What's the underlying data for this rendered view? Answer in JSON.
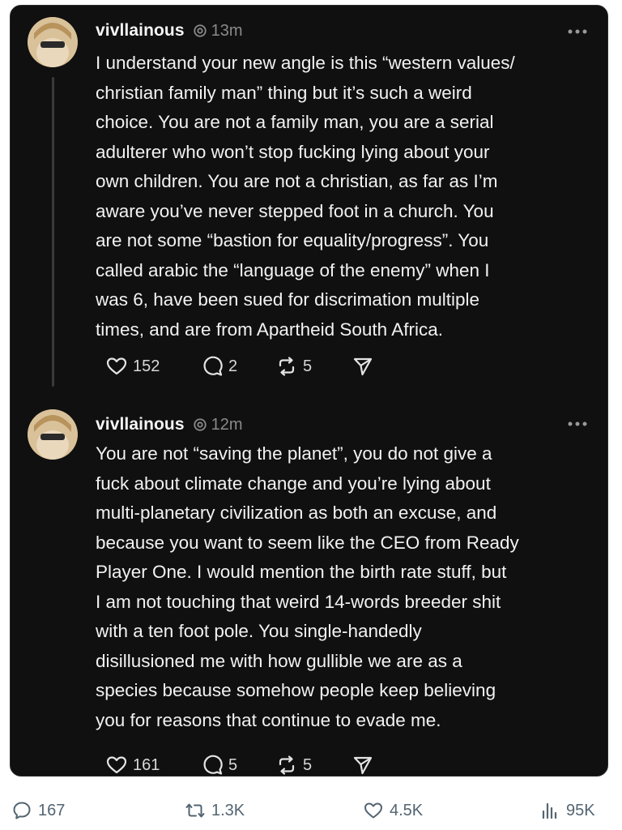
{
  "posts": [
    {
      "username": "vivllainous",
      "time": "13m",
      "text": "I understand your new angle is this “western values/\nchristian family man” thing but it’s such a weird\nchoice. You are not a family man, you are a serial\nadulterer who won’t stop fucking lying about your\nown children. You are not a christian, as far as I’m\naware you’ve never stepped foot in a church. You\nare not some “bastion for equality/progress”. You\ncalled arabic the “language of the enemy” when I\nwas 6, have been sued for discrimation multiple\ntimes, and are from Apartheid South Africa.",
      "likes": "152",
      "replies": "2",
      "reposts": "5"
    },
    {
      "username": "vivllainous",
      "time": "12m",
      "text": "You are not “saving the planet”, you do not give a\nfuck about climate change and you’re lying about\nmulti-planetary civilization as both an excuse, and\nbecause you want to seem like the CEO from Ready\nPlayer One. I would mention the birth rate stuff, but\nI am not touching that weird 14-words breeder shit\nwith a ten foot pole. You single-handedly\ndisillusioned me with how gullible we are as a\nspecies because somehow people keep believing\nyou for reasons that continue to evade me.",
      "likes": "161",
      "replies": "5",
      "reposts": "5"
    }
  ],
  "footer": {
    "replies": "167",
    "retweets": "1.3K",
    "likes": "4.5K",
    "views": "95K"
  },
  "icons": {
    "handle": "threads-badge-icon",
    "more": "more-dots-icon",
    "like": "heart-icon",
    "reply": "comment-bubble-icon",
    "repost": "repost-icon",
    "share": "send-icon",
    "views": "bar-chart-icon"
  },
  "colors": {
    "card_background": "#101010",
    "text": "#f2f2f2",
    "muted": "#8a8a8a",
    "footer_icons": "#536471"
  }
}
